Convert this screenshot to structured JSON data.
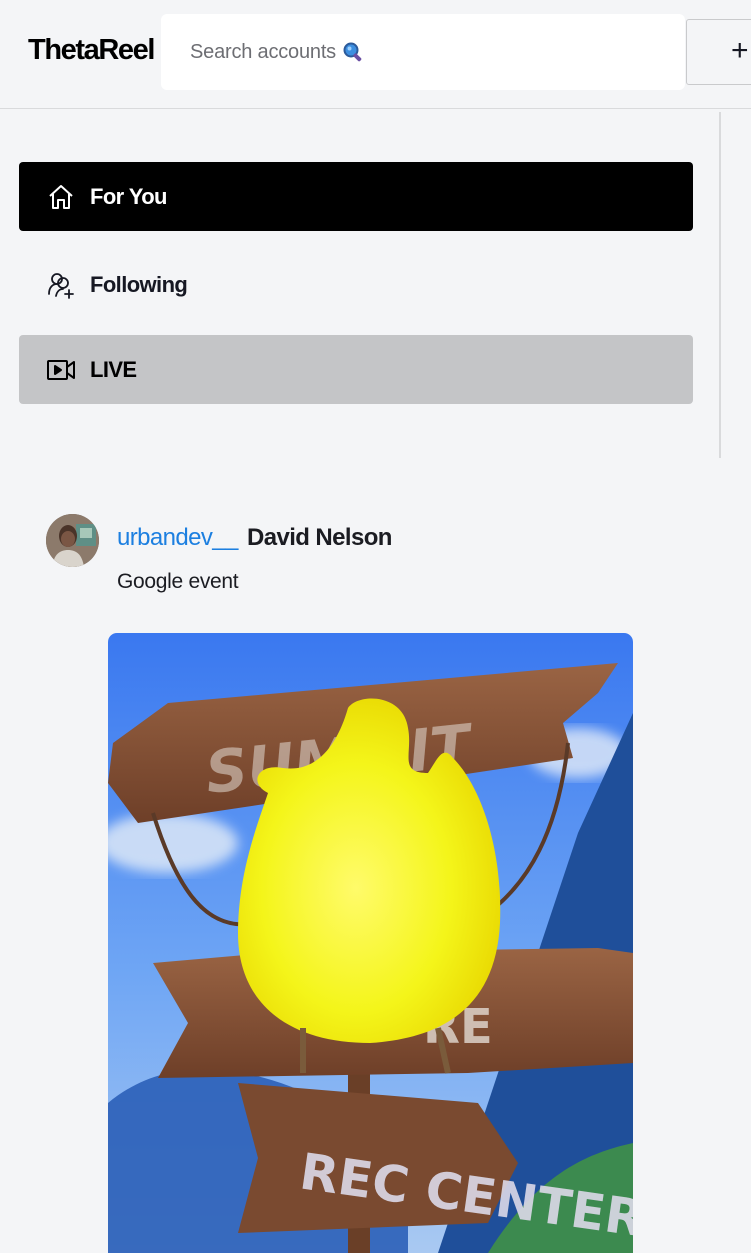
{
  "header": {
    "logo": "ThetaReel",
    "search_placeholder": "Search accounts",
    "upload_symbol": "+"
  },
  "sidebar": {
    "items": [
      {
        "label": "For You",
        "icon": "home-icon",
        "state": "active"
      },
      {
        "label": "Following",
        "icon": "following-users-icon",
        "state": "default"
      },
      {
        "label": "LIVE",
        "icon": "live-video-icon",
        "state": "hover"
      }
    ]
  },
  "feed": {
    "post": {
      "username": "urbandev__",
      "display_name": "David Nelson",
      "caption": "Google event",
      "video_sign_texts": [
        "SUMMIT",
        "RE",
        "REC CENTER"
      ]
    }
  },
  "colors": {
    "active_bg": "#000000",
    "hover_bg": "#c4c5c7",
    "username_link": "#1c7fe0",
    "page_bg": "#f4f5f7"
  }
}
